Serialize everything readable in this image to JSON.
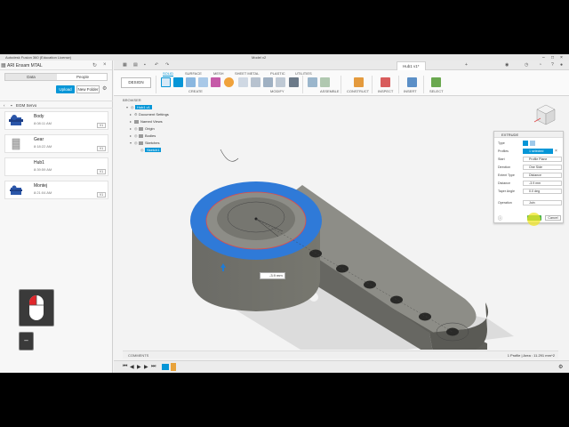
{
  "window": {
    "title": "Autodesk Fusion 360 (Education License)",
    "center_title": "Model v2"
  },
  "data_panel": {
    "team": "ARI Ensam MTAL",
    "tabs": [
      "Data",
      "People"
    ],
    "upload_label": "Upload",
    "new_folder_label": "New Folder",
    "folder": "EGM Servo",
    "files": [
      {
        "name": "Body",
        "time": "8:08:11 AM",
        "version": "V1"
      },
      {
        "name": "Gear",
        "time": "8:18:22 AM",
        "version": "V1"
      },
      {
        "name": "Hub1",
        "time": "8:39:59 AM",
        "version": "V1"
      },
      {
        "name": "Montej",
        "time": "8:21:04 AM",
        "version": "V1"
      }
    ]
  },
  "tabs": {
    "active_doc": "Hub1 v1*"
  },
  "toolbar": {
    "workspace_button": "DESIGN",
    "workspace_tabs": [
      "SOLID",
      "SURFACE",
      "MESH",
      "SHEET METAL",
      "PLASTIC",
      "UTILITIES"
    ],
    "groups": [
      "CREATE",
      "MODIFY",
      "ASSEMBLE",
      "CONSTRUCT",
      "INSPECT",
      "INSERT",
      "SELECT"
    ]
  },
  "browser": {
    "header": "BROWSER",
    "root": "Hub1 v1",
    "items": [
      "Document Settings",
      "Named Views",
      "Origin",
      "Bodies",
      "Sketches",
      "Sketch1"
    ]
  },
  "extrude_dialog": {
    "title": "EXTRUDE",
    "rows": [
      {
        "label": "Type",
        "value": ""
      },
      {
        "label": "Profiles",
        "value": "1 selected"
      },
      {
        "label": "Start",
        "value": "Profile Plane"
      },
      {
        "label": "Direction",
        "value": "One Side"
      },
      {
        "label": "Extent Type",
        "value": "Distance"
      },
      {
        "label": "Distance",
        "value": "-3.9 mm"
      },
      {
        "label": "Taper Angle",
        "value": "0.0 deg"
      },
      {
        "label": "Operation",
        "value": "Join"
      }
    ],
    "cancel_label": "Cancel"
  },
  "viewport": {
    "dimension_value": "-3.9 mm"
  },
  "bottom": {
    "comments_label": "COMMENTS",
    "status": "1 Profile | Area : 11.291 mm^2"
  },
  "colors": {
    "accent": "#0696d7",
    "body": "#6f6f6a",
    "face_top": "#8a8a84",
    "selected_face": "#2f7ad8",
    "ok": "#3fae49"
  }
}
